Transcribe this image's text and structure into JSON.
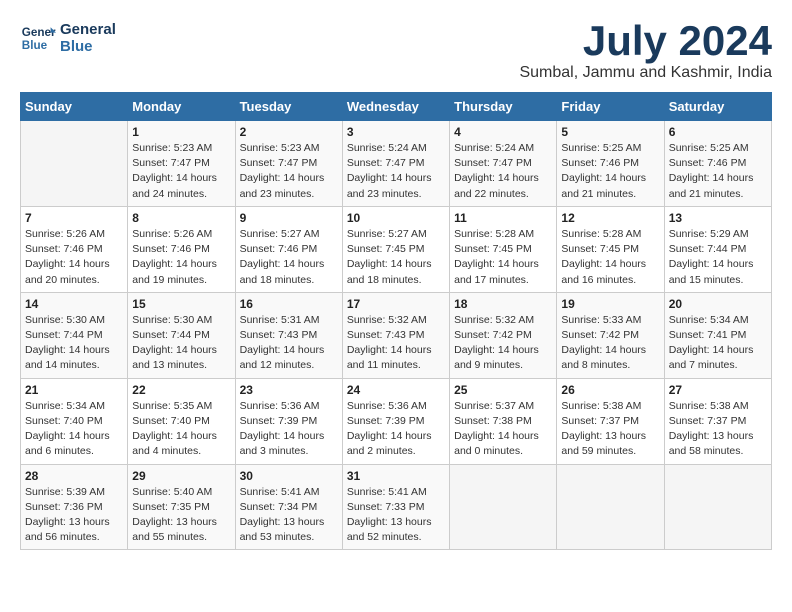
{
  "logo": {
    "line1": "General",
    "line2": "Blue"
  },
  "title": "July 2024",
  "subtitle": "Sumbal, Jammu and Kashmir, India",
  "weekdays": [
    "Sunday",
    "Monday",
    "Tuesday",
    "Wednesday",
    "Thursday",
    "Friday",
    "Saturday"
  ],
  "weeks": [
    [
      {
        "day": "",
        "info": ""
      },
      {
        "day": "1",
        "info": "Sunrise: 5:23 AM\nSunset: 7:47 PM\nDaylight: 14 hours\nand 24 minutes."
      },
      {
        "day": "2",
        "info": "Sunrise: 5:23 AM\nSunset: 7:47 PM\nDaylight: 14 hours\nand 23 minutes."
      },
      {
        "day": "3",
        "info": "Sunrise: 5:24 AM\nSunset: 7:47 PM\nDaylight: 14 hours\nand 23 minutes."
      },
      {
        "day": "4",
        "info": "Sunrise: 5:24 AM\nSunset: 7:47 PM\nDaylight: 14 hours\nand 22 minutes."
      },
      {
        "day": "5",
        "info": "Sunrise: 5:25 AM\nSunset: 7:46 PM\nDaylight: 14 hours\nand 21 minutes."
      },
      {
        "day": "6",
        "info": "Sunrise: 5:25 AM\nSunset: 7:46 PM\nDaylight: 14 hours\nand 21 minutes."
      }
    ],
    [
      {
        "day": "7",
        "info": "Sunrise: 5:26 AM\nSunset: 7:46 PM\nDaylight: 14 hours\nand 20 minutes."
      },
      {
        "day": "8",
        "info": "Sunrise: 5:26 AM\nSunset: 7:46 PM\nDaylight: 14 hours\nand 19 minutes."
      },
      {
        "day": "9",
        "info": "Sunrise: 5:27 AM\nSunset: 7:46 PM\nDaylight: 14 hours\nand 18 minutes."
      },
      {
        "day": "10",
        "info": "Sunrise: 5:27 AM\nSunset: 7:45 PM\nDaylight: 14 hours\nand 18 minutes."
      },
      {
        "day": "11",
        "info": "Sunrise: 5:28 AM\nSunset: 7:45 PM\nDaylight: 14 hours\nand 17 minutes."
      },
      {
        "day": "12",
        "info": "Sunrise: 5:28 AM\nSunset: 7:45 PM\nDaylight: 14 hours\nand 16 minutes."
      },
      {
        "day": "13",
        "info": "Sunrise: 5:29 AM\nSunset: 7:44 PM\nDaylight: 14 hours\nand 15 minutes."
      }
    ],
    [
      {
        "day": "14",
        "info": "Sunrise: 5:30 AM\nSunset: 7:44 PM\nDaylight: 14 hours\nand 14 minutes."
      },
      {
        "day": "15",
        "info": "Sunrise: 5:30 AM\nSunset: 7:44 PM\nDaylight: 14 hours\nand 13 minutes."
      },
      {
        "day": "16",
        "info": "Sunrise: 5:31 AM\nSunset: 7:43 PM\nDaylight: 14 hours\nand 12 minutes."
      },
      {
        "day": "17",
        "info": "Sunrise: 5:32 AM\nSunset: 7:43 PM\nDaylight: 14 hours\nand 11 minutes."
      },
      {
        "day": "18",
        "info": "Sunrise: 5:32 AM\nSunset: 7:42 PM\nDaylight: 14 hours\nand 9 minutes."
      },
      {
        "day": "19",
        "info": "Sunrise: 5:33 AM\nSunset: 7:42 PM\nDaylight: 14 hours\nand 8 minutes."
      },
      {
        "day": "20",
        "info": "Sunrise: 5:34 AM\nSunset: 7:41 PM\nDaylight: 14 hours\nand 7 minutes."
      }
    ],
    [
      {
        "day": "21",
        "info": "Sunrise: 5:34 AM\nSunset: 7:40 PM\nDaylight: 14 hours\nand 6 minutes."
      },
      {
        "day": "22",
        "info": "Sunrise: 5:35 AM\nSunset: 7:40 PM\nDaylight: 14 hours\nand 4 minutes."
      },
      {
        "day": "23",
        "info": "Sunrise: 5:36 AM\nSunset: 7:39 PM\nDaylight: 14 hours\nand 3 minutes."
      },
      {
        "day": "24",
        "info": "Sunrise: 5:36 AM\nSunset: 7:39 PM\nDaylight: 14 hours\nand 2 minutes."
      },
      {
        "day": "25",
        "info": "Sunrise: 5:37 AM\nSunset: 7:38 PM\nDaylight: 14 hours\nand 0 minutes."
      },
      {
        "day": "26",
        "info": "Sunrise: 5:38 AM\nSunset: 7:37 PM\nDaylight: 13 hours\nand 59 minutes."
      },
      {
        "day": "27",
        "info": "Sunrise: 5:38 AM\nSunset: 7:37 PM\nDaylight: 13 hours\nand 58 minutes."
      }
    ],
    [
      {
        "day": "28",
        "info": "Sunrise: 5:39 AM\nSunset: 7:36 PM\nDaylight: 13 hours\nand 56 minutes."
      },
      {
        "day": "29",
        "info": "Sunrise: 5:40 AM\nSunset: 7:35 PM\nDaylight: 13 hours\nand 55 minutes."
      },
      {
        "day": "30",
        "info": "Sunrise: 5:41 AM\nSunset: 7:34 PM\nDaylight: 13 hours\nand 53 minutes."
      },
      {
        "day": "31",
        "info": "Sunrise: 5:41 AM\nSunset: 7:33 PM\nDaylight: 13 hours\nand 52 minutes."
      },
      {
        "day": "",
        "info": ""
      },
      {
        "day": "",
        "info": ""
      },
      {
        "day": "",
        "info": ""
      }
    ]
  ]
}
